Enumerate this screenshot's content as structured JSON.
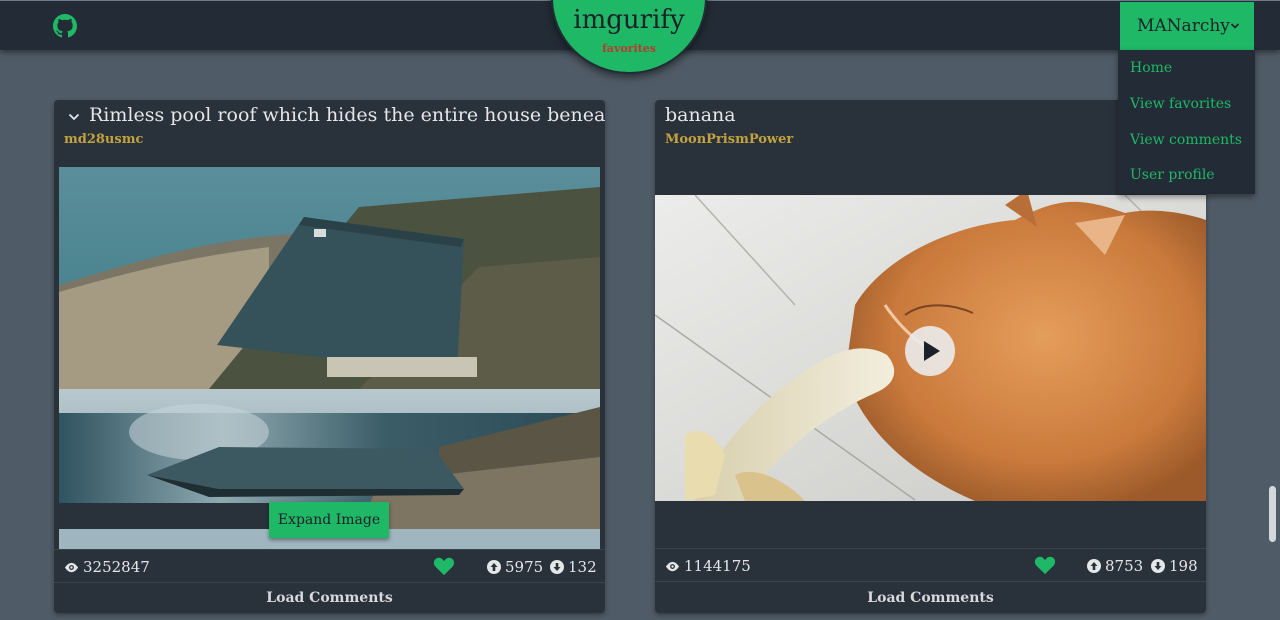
{
  "app": {
    "title": "imgurify",
    "subtitle": "favorites"
  },
  "user_menu": {
    "username": "MANarchy",
    "items": [
      "Home",
      "View favorites",
      "View comments",
      "User profile"
    ]
  },
  "posts": [
    {
      "title": "Rimless pool roof which hides the entire house beneath it",
      "author": "md28usmc",
      "views": "3252847",
      "upvotes": "5975",
      "downvotes": "132",
      "expand_label": "Expand Image",
      "load_comments": "Load Comments"
    },
    {
      "title": "banana",
      "author": "MoonPrismPower",
      "views": "1144175",
      "upvotes": "8753",
      "downvotes": "198",
      "load_comments": "Load Comments"
    }
  ],
  "icons": {
    "github": "github-icon",
    "views": "eye-icon",
    "favorite": "heart-icon",
    "upvote": "arrow-up-circle-icon",
    "downvote": "arrow-down-circle-icon",
    "play": "play-icon"
  },
  "colors": {
    "accent": "#1fb866",
    "navbar": "#232c36",
    "card": "#29313b",
    "author": "#c3a33f",
    "background": "#4f5b66"
  }
}
